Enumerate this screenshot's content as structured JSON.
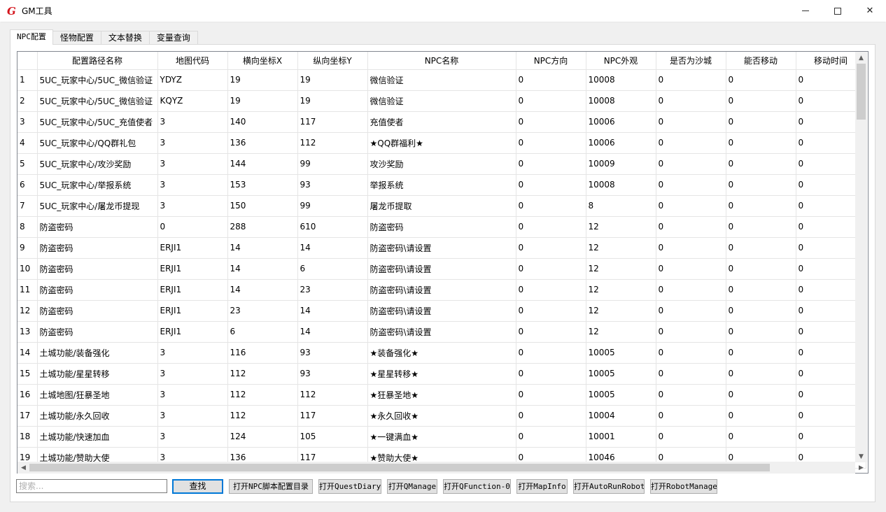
{
  "window": {
    "title": "GM工具",
    "icon": "G",
    "controls": {
      "minimize": "minimize-icon",
      "maximize": "maximize-icon",
      "close": "✕"
    }
  },
  "tabs": [
    {
      "label": "NPC配置",
      "active": true
    },
    {
      "label": "怪物配置",
      "active": false
    },
    {
      "label": "文本替换",
      "active": false
    },
    {
      "label": "变量查询",
      "active": false
    }
  ],
  "table": {
    "columns": [
      "",
      "配置路径名称",
      "地图代码",
      "横向坐标X",
      "纵向坐标Y",
      "NPC名称",
      "NPC方向",
      "NPC外观",
      "是否为沙城",
      "能否移动",
      "移动时间"
    ],
    "rows": [
      [
        "1",
        "5UC_玩家中心/5UC_微信验证",
        "YDYZ",
        "19",
        "19",
        "微信验证",
        "0",
        "10008",
        "0",
        "0",
        "0"
      ],
      [
        "2",
        "5UC_玩家中心/5UC_微信验证",
        "KQYZ",
        "19",
        "19",
        "微信验证",
        "0",
        "10008",
        "0",
        "0",
        "0"
      ],
      [
        "3",
        "5UC_玩家中心/5UC_充值使者",
        "3",
        "140",
        "117",
        "充值使者",
        "0",
        "10006",
        "0",
        "0",
        "0"
      ],
      [
        "4",
        "5UC_玩家中心/QQ群礼包",
        "3",
        "136",
        "112",
        "★QQ群福利★",
        "0",
        "10006",
        "0",
        "0",
        "0"
      ],
      [
        "5",
        "5UC_玩家中心/攻沙奖励",
        "3",
        "144",
        "99",
        "攻沙奖励",
        "0",
        "10009",
        "0",
        "0",
        "0"
      ],
      [
        "6",
        "5UC_玩家中心/举报系统",
        "3",
        "153",
        "93",
        "举报系统",
        "0",
        "10008",
        "0",
        "0",
        "0"
      ],
      [
        "7",
        "5UC_玩家中心/屠龙币提现",
        "3",
        "150",
        "99",
        "屠龙币提取",
        "0",
        "8",
        "0",
        "0",
        "0"
      ],
      [
        "8",
        "防盗密码",
        "0",
        "288",
        "610",
        "防盗密码",
        "0",
        "12",
        "0",
        "0",
        "0"
      ],
      [
        "9",
        "防盗密码",
        "ERJI1",
        "14",
        "14",
        "防盗密码\\请设置",
        "0",
        "12",
        "0",
        "0",
        "0"
      ],
      [
        "10",
        "防盗密码",
        "ERJI1",
        "14",
        "6",
        "防盗密码\\请设置",
        "0",
        "12",
        "0",
        "0",
        "0"
      ],
      [
        "11",
        "防盗密码",
        "ERJI1",
        "14",
        "23",
        "防盗密码\\请设置",
        "0",
        "12",
        "0",
        "0",
        "0"
      ],
      [
        "12",
        "防盗密码",
        "ERJI1",
        "23",
        "14",
        "防盗密码\\请设置",
        "0",
        "12",
        "0",
        "0",
        "0"
      ],
      [
        "13",
        "防盗密码",
        "ERJI1",
        "6",
        "14",
        "防盗密码\\请设置",
        "0",
        "12",
        "0",
        "0",
        "0"
      ],
      [
        "14",
        "土城功能/装备强化",
        "3",
        "116",
        "93",
        "★装备强化★",
        "0",
        "10005",
        "0",
        "0",
        "0"
      ],
      [
        "15",
        "土城功能/星星转移",
        "3",
        "112",
        "93",
        "★星星转移★",
        "0",
        "10005",
        "0",
        "0",
        "0"
      ],
      [
        "16",
        "土城地图/狂暴圣地",
        "3",
        "112",
        "112",
        "★狂暴圣地★",
        "0",
        "10005",
        "0",
        "0",
        "0"
      ],
      [
        "17",
        "土城功能/永久回收",
        "3",
        "112",
        "117",
        "★永久回收★",
        "0",
        "10004",
        "0",
        "0",
        "0"
      ],
      [
        "18",
        "土城功能/快速加血",
        "3",
        "124",
        "105",
        "★一键满血★",
        "0",
        "10001",
        "0",
        "0",
        "0"
      ],
      [
        "19",
        "土城功能/赞助大使",
        "3",
        "136",
        "117",
        "★赞助大使★",
        "0",
        "10046",
        "0",
        "0",
        "0"
      ]
    ]
  },
  "scrollbars": {
    "up": "▲",
    "down": "▼",
    "left": "◀",
    "right": "▶"
  },
  "bottom": {
    "search_placeholder": "搜索...",
    "search_value": "",
    "find_button": "查找",
    "buttons": [
      "打开NPC脚本配置目录",
      "打开QuestDiary",
      "打开QManage",
      "打开QFunction-0",
      "打开MapInfo",
      "打开AutoRunRobot",
      "打开RobotManage"
    ]
  }
}
